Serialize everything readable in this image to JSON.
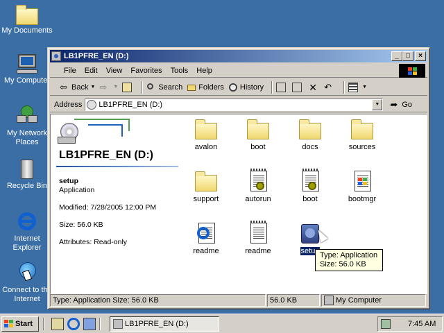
{
  "desktop": {
    "icons": [
      {
        "label": "My Documents",
        "icon": "my-documents-icon"
      },
      {
        "label": "My Computer",
        "icon": "my-computer-icon"
      },
      {
        "label": "My Network Places",
        "icon": "network-places-icon"
      },
      {
        "label": "Recycle Bin",
        "icon": "recycle-bin-icon"
      },
      {
        "label": "Internet Explorer",
        "icon": "internet-explorer-icon"
      },
      {
        "label": "Connect to the Internet",
        "icon": "connect-internet-icon"
      }
    ]
  },
  "window": {
    "title": "LB1PFRE_EN (D:)",
    "caption_buttons": {
      "minimize": "_",
      "maximize": "□",
      "close": "×"
    },
    "menu": [
      "File",
      "Edit",
      "View",
      "Favorites",
      "Tools",
      "Help"
    ],
    "toolbar": {
      "back": "Back",
      "search": "Search",
      "folders": "Folders",
      "history": "History"
    },
    "address": {
      "label": "Address",
      "value": "LB1PFRE_EN (D:)",
      "go": "Go"
    },
    "info_pane": {
      "drive_title": "LB1PFRE_EN (D:)",
      "item_name": "setup",
      "item_type": "Application",
      "modified": "Modified: 7/28/2005 12:00 PM",
      "size": "Size: 56.0 KB",
      "attributes": "Attributes: Read-only"
    },
    "files": [
      {
        "name": "avalon",
        "kind": "folder"
      },
      {
        "name": "boot",
        "kind": "folder"
      },
      {
        "name": "docs",
        "kind": "folder"
      },
      {
        "name": "sources",
        "kind": "folder"
      },
      {
        "name": "support",
        "kind": "folder"
      },
      {
        "name": "autorun",
        "kind": "ini"
      },
      {
        "name": "boot",
        "kind": "ini"
      },
      {
        "name": "bootmgr",
        "kind": "system"
      },
      {
        "name": "readme",
        "kind": "html"
      },
      {
        "name": "readme",
        "kind": "text"
      },
      {
        "name": "setup",
        "kind": "application",
        "selected": true
      }
    ],
    "tooltip": {
      "line1": "Type: Application",
      "line2": "Size: 56.0 KB"
    },
    "status": {
      "main": "Type: Application Size: 56.0 KB",
      "size": "56.0 KB",
      "zone": "My Computer"
    }
  },
  "taskbar": {
    "start": "Start",
    "task": "LB1PFRE_EN (D:)",
    "clock": "7:45 AM"
  },
  "colors": {
    "desktop": "#3a6ea5",
    "titlebar_start": "#0a246a",
    "titlebar_end": "#a6caf0",
    "selection": "#0a246a",
    "tooltip_bg": "#ffffe1"
  }
}
